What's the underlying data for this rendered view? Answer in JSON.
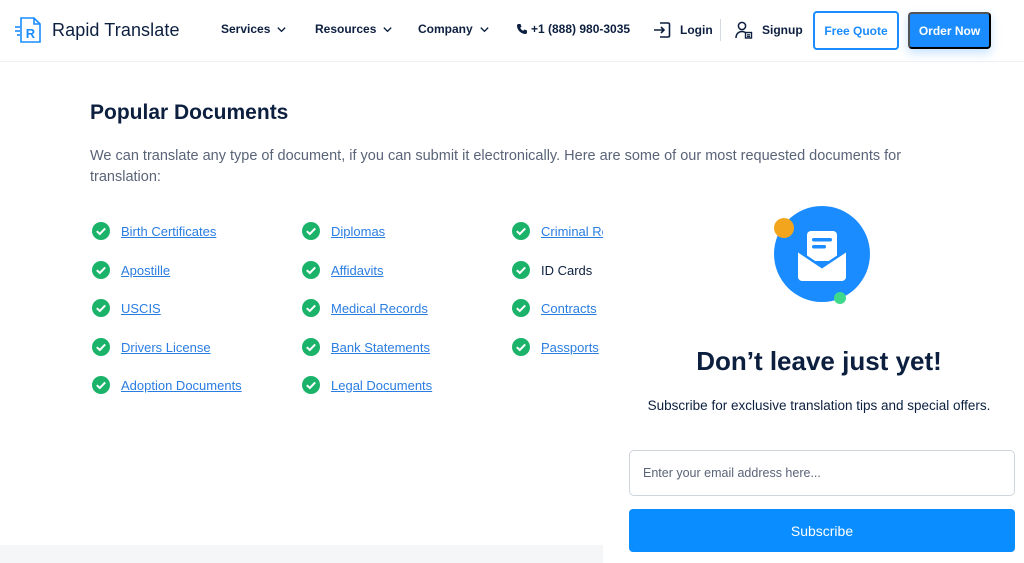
{
  "brand": {
    "name": "Rapid Translate",
    "accent": "#1a8cff",
    "success": "#1bb36a"
  },
  "header": {
    "nav": [
      {
        "label": "Services"
      },
      {
        "label": "Resources"
      },
      {
        "label": "Company"
      }
    ],
    "phone": "+1 (888) 980-3035",
    "login_label": "Login",
    "signup_label": "Signup",
    "free_quote_label": "Free Quote",
    "order_now_label": "Order Now"
  },
  "main": {
    "title": "Popular Documents",
    "intro": "We can translate any type of document, if you can submit it electronically. Here are some of our most requested documents for translation:",
    "columns": [
      [
        {
          "label": "Birth Certificates",
          "link": true
        },
        {
          "label": "Apostille",
          "link": true
        },
        {
          "label": "USCIS",
          "link": true
        },
        {
          "label": "Drivers License",
          "link": true
        },
        {
          "label": "Adoption Documents",
          "link": true
        }
      ],
      [
        {
          "label": "Diplomas",
          "link": true
        },
        {
          "label": "Affidavits",
          "link": true
        },
        {
          "label": "Medical Records",
          "link": true
        },
        {
          "label": "Bank Statements",
          "link": true
        },
        {
          "label": "Legal Documents",
          "link": true
        }
      ],
      [
        {
          "label": "Criminal Re",
          "link": true
        },
        {
          "label": "ID Cards",
          "link": false
        },
        {
          "label": "Contracts",
          "link": true
        },
        {
          "label": "Passports",
          "link": true
        }
      ]
    ]
  },
  "popup": {
    "title": "Don’t leave just yet!",
    "subtitle": "Subscribe for exclusive translation tips and special offers.",
    "email_placeholder": "Enter your email address here...",
    "email_value": "",
    "subscribe_label": "Subscribe"
  }
}
